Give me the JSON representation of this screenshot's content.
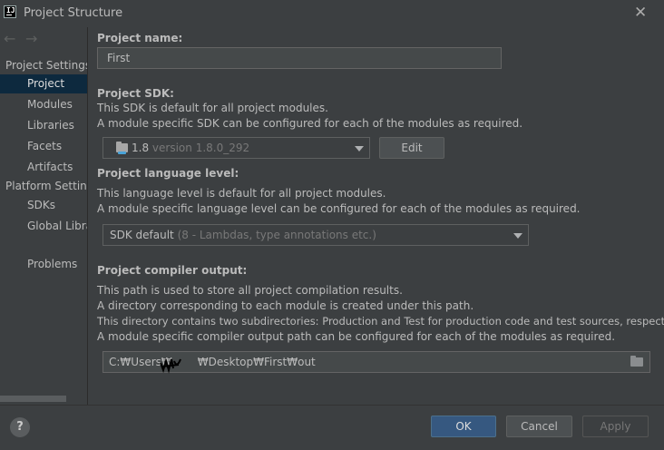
{
  "window": {
    "title": "Project Structure"
  },
  "sidebar": {
    "sections": [
      {
        "header": "Project Settings",
        "items": [
          {
            "label": "Project",
            "selected": true
          },
          {
            "label": "Modules"
          },
          {
            "label": "Libraries"
          },
          {
            "label": "Facets"
          },
          {
            "label": "Artifacts"
          }
        ]
      },
      {
        "header": "Platform Settings",
        "items": [
          {
            "label": "SDKs"
          },
          {
            "label": "Global Libraries"
          }
        ]
      }
    ],
    "extra_items": [
      {
        "label": "Problems"
      }
    ]
  },
  "content": {
    "project_name": {
      "label": "Project name:",
      "value": "First"
    },
    "project_sdk": {
      "label": "Project SDK:",
      "desc1": "This SDK is default for all project modules.",
      "desc2": "A module specific SDK can be configured for each of the modules as required.",
      "selected_name": "1.8",
      "selected_version": "version 1.8.0_292",
      "edit_label": "Edit"
    },
    "language_level": {
      "label": "Project language level:",
      "desc1": "This language level is default for all project modules.",
      "desc2": "A module specific language level can be configured for each of the modules as required.",
      "selected": "SDK default",
      "selected_detail": "(8 - Lambdas, type annotations etc.)"
    },
    "compiler_output": {
      "label": "Project compiler output:",
      "desc1": "This path is used to store all project compilation results.",
      "desc2": "A directory corresponding to each module is created under this path.",
      "desc3": "This directory contains two subdirectories: Production and Test for production code and test sources, respectively.",
      "desc4": "A module specific compiler output path can be configured for each of the modules as required.",
      "path_prefix": "C:₩Users₩",
      "path_suffix": "₩Desktop₩First₩out"
    }
  },
  "footer": {
    "ok": "OK",
    "cancel": "Cancel",
    "apply": "Apply",
    "help": "?"
  },
  "colors": {
    "selection": "#0d293e",
    "ok_button": "#365880",
    "background": "#3c3f41",
    "sdk_icon_accent": "#4aa3d8"
  }
}
